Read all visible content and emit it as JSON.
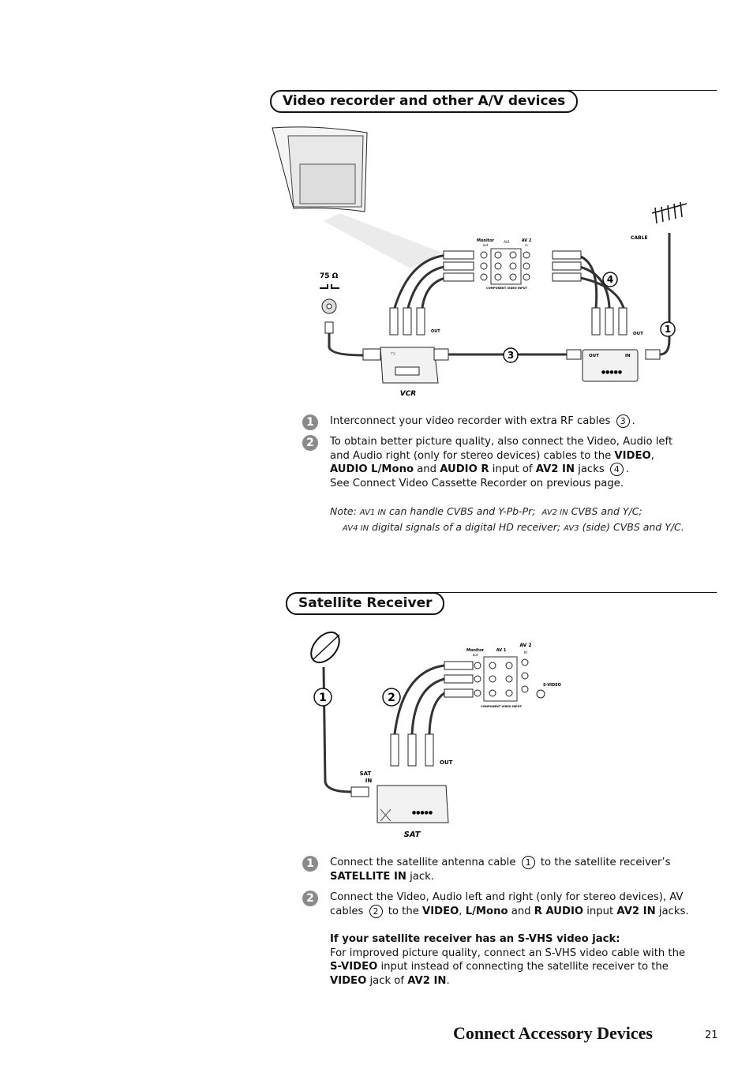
{
  "section1": {
    "title": "Video recorder and other A/V devices",
    "diagram": {
      "monitor_out": "Monitor",
      "monitor_out2": "out",
      "av1_in": "AV1",
      "av1_in2": "in",
      "av2_in": "AV 2",
      "av2_in2": "in",
      "component": "COMPONENT VIDEO INPUT",
      "cable": "CABLE",
      "ohm": "75 Ω",
      "out_vcr": "OUT",
      "out_dev": "OUT",
      "in_dev": "IN",
      "out_dev2": "OUT",
      "tv": "TV",
      "vcr": "VCR",
      "callouts": [
        "1",
        "3",
        "4"
      ]
    },
    "steps": [
      {
        "num": "1",
        "text": "Interconnect your video recorder with extra RF cables",
        "ref": "3"
      },
      {
        "num": "2",
        "line1": "To obtain better picture quality, also connect the Video, Audio left and Audio right (only for stereo devices) cables to the ",
        "b1": "VIDEO",
        "sep": ", ",
        "b2": "AUDIO L/Mono",
        "and": " and ",
        "b3": "AUDIO R",
        "mid": " input of ",
        "b4": "AV2 IN",
        "end": " jacks",
        "ref": "4",
        "line2": "See Connect Video Cassette Recorder on previous page."
      }
    ],
    "note": {
      "label": "Note:",
      "av1": "AV1 IN",
      "t1": "can handle CVBS and Y-Pb-Pr;",
      "av2": "AV2 IN",
      "t2": "CVBS and Y/C;",
      "av4": "AV4 IN",
      "t3": "digital signals of a digital HD receiver;",
      "av3": "AV3",
      "t4": "(side) CVBS and Y/C."
    }
  },
  "section2": {
    "title": "Satellite Receiver",
    "diagram": {
      "monitor_out": "Monitor",
      "monitor_out2": "out",
      "av1_in": "AV 1",
      "av1_in2": "in",
      "av2_in": "AV 2",
      "av2_in2": "in",
      "component": "COMPONENT VIDEO INPUT",
      "svideo": "S-VIDEO",
      "out": "OUT",
      "sat_in": "SAT",
      "sat_in2": "IN",
      "sat": "SAT",
      "callouts": [
        "1",
        "2"
      ]
    },
    "steps": [
      {
        "num": "1",
        "t1": "Connect the satellite antenna cable",
        "ref": "1",
        "t2": " to the satellite receiver’s ",
        "b1": "SATELLITE IN",
        "t3": " jack."
      },
      {
        "num": "2",
        "t1": "Connect the Video, Audio left and right (only for stereo devices), AV cables ",
        "ref": "2",
        "t2": " to the ",
        "b1": "VIDEO",
        "sep": ", ",
        "b2": "L/Mono",
        "and": " and ",
        "b3": "R AUDIO",
        "t3": " input ",
        "b4": "AV2 IN",
        "t4": " jacks."
      }
    ],
    "svhs": {
      "heading": "If your satellite receiver has an S-VHS video jack:",
      "t1": "For improved picture quality, connect an S-VHS video cable with the ",
      "b1": "S-VIDEO",
      "t2": " input instead of connecting the satellite receiver to the ",
      "b2": "VIDEO",
      "t3": " jack of ",
      "b3": "AV2 IN",
      "t4": "."
    }
  },
  "footer": {
    "title": "Connect Accessory Devices",
    "page": "21"
  }
}
